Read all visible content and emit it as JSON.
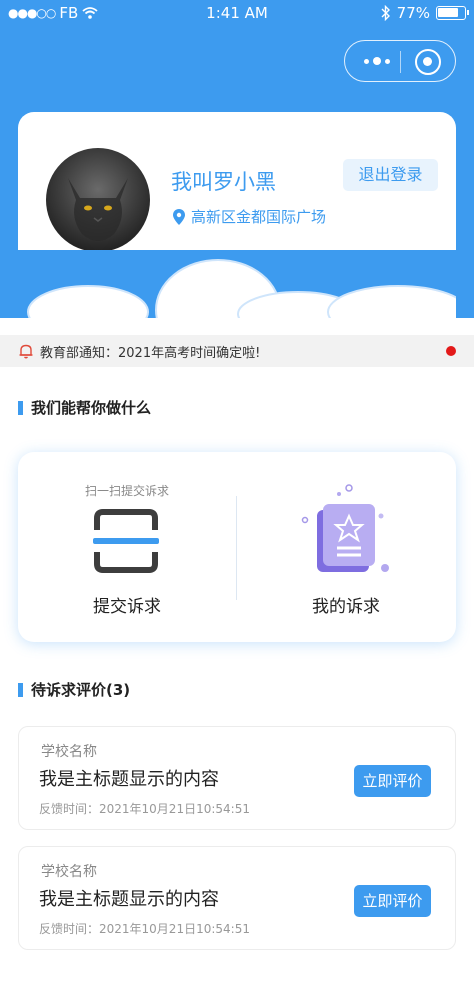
{
  "status_bar": {
    "carrier": "FB",
    "time": "1:41 AM",
    "battery": "77%",
    "icons": [
      "signal-dots-icon",
      "wifi-icon",
      "bluetooth-icon",
      "battery-icon"
    ]
  },
  "capsule": {
    "icons": [
      "more-icon",
      "close-target-icon"
    ]
  },
  "profile": {
    "name": "我叫罗小黑",
    "location": "高新区金都国际广场",
    "logout_label": "退出登录"
  },
  "notice": {
    "text": "教育部通知：2021年高考时间确定啦!"
  },
  "help_section": {
    "title": "我们能帮你做什么",
    "scan_hint": "扫一扫提交诉求",
    "submit_label": "提交诉求",
    "my_label": "我的诉求"
  },
  "pending_section": {
    "title": "待诉求评价(3)",
    "items": [
      {
        "school": "学校名称",
        "title": "我是主标题显示的内容",
        "time": "反馈时间：2021年10月21日10:54:51",
        "button": "立即评价"
      },
      {
        "school": "学校名称",
        "title": "我是主标题显示的内容",
        "time": "反馈时间：2021年10月21日10:54:51",
        "button": "立即评价"
      }
    ]
  },
  "colors": {
    "primary": "#3d9bef",
    "notice_dot": "#e31919",
    "card_bg": "#ffffff"
  }
}
